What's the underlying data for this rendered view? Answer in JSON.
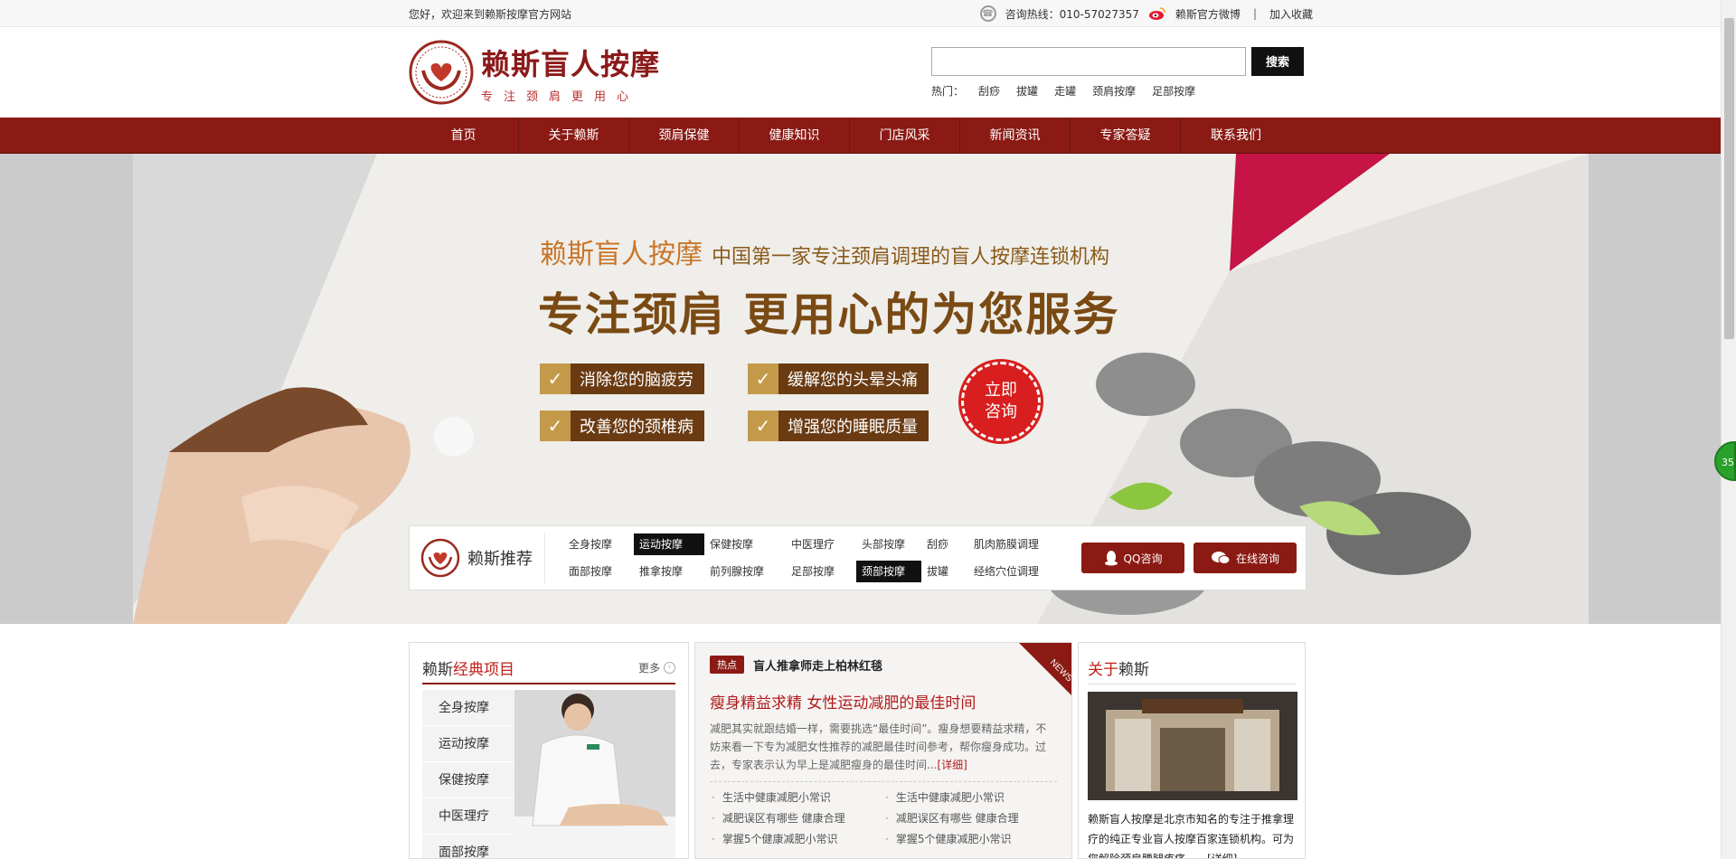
{
  "topbar": {
    "welcome": "您好，欢迎来到赖斯按摩官方网站",
    "hotline": "咨询热线：010-57027357",
    "weibo": "赖斯官方微博",
    "separator": "|",
    "favorite": "加入收藏"
  },
  "header": {
    "logo_title": "赖斯盲人按摩",
    "logo_sub": "专注颈肩更用心",
    "search_button": "搜索",
    "hot_label": "热门：",
    "hot_links": [
      "刮痧",
      "拔罐",
      "走罐",
      "颈肩按摩",
      "足部按摩"
    ]
  },
  "nav": [
    "首页",
    "关于赖斯",
    "颈肩保健",
    "健康知识",
    "门店风采",
    "新闻资讯",
    "专家答疑",
    "联系我们"
  ],
  "banner": {
    "brand": "赖斯盲人按摩",
    "slogan": "中国第一家专注颈肩调理的盲人按摩连锁机构",
    "headline": "专注颈肩 更用心的为您服务",
    "features": [
      "消除您的脑疲劳",
      "缓解您的头晕头痛",
      "改善您的颈椎病",
      "增强您的睡眠质量"
    ],
    "consult_line1": "立即",
    "consult_line2": "咨询"
  },
  "recommend": {
    "title": "赖斯推荐",
    "items": [
      "全身按摩",
      "运动按摩",
      "保健按摩",
      "中医理疗",
      "头部按摩",
      "刮痧",
      "肌肉筋膜调理",
      "面部按摩",
      "推拿按摩",
      "前列腺按摩",
      "足部按摩",
      "颈部按摩",
      "拔罐",
      "经络穴位调理"
    ],
    "active": [
      1,
      11
    ],
    "qq_button": "QQ咨询",
    "online_button": "在线咨询"
  },
  "classic": {
    "title_a": "赖斯",
    "title_b": "经典项目",
    "more": "更多",
    "items": [
      "全身按摩",
      "运动按摩",
      "保健按摩",
      "中医理疗",
      "面部按摩"
    ]
  },
  "news": {
    "tag": "热点",
    "hot_title": "盲人推拿师走上柏林红毯",
    "corner": "NEWS",
    "headline": "瘦身精益求精 女性运动减肥的最佳时间",
    "summary": "减肥其实就跟结婚一样，需要挑选“最佳时间”。瘦身想要精益求精，不妨来看一下专为减肥女性推荐的减肥最佳时间参考，帮你瘦身成功。过去，专家表示认为早上是减肥瘦身的最佳时间...",
    "detail": "[详细]",
    "list": [
      "生活中健康减肥小常识",
      "生活中健康减肥小常识",
      "减肥误区有哪些 健康合理",
      "减肥误区有哪些 健康合理",
      "掌握5个健康减肥小常识",
      "掌握5个健康减肥小常识"
    ]
  },
  "about": {
    "title_a": "关于",
    "title_b": "赖斯",
    "text": "赖斯盲人按摩是北京市知名的专注于推拿理疗的纯正专业盲人按摩百家连锁机构。可为您解除颈肩腰腿疼痛……[详细]"
  },
  "float_badge": "35",
  "colors": {
    "brand_red": "#8b1a14",
    "accent_orange": "#c8762a",
    "banner_brown": "#7a4a14"
  }
}
